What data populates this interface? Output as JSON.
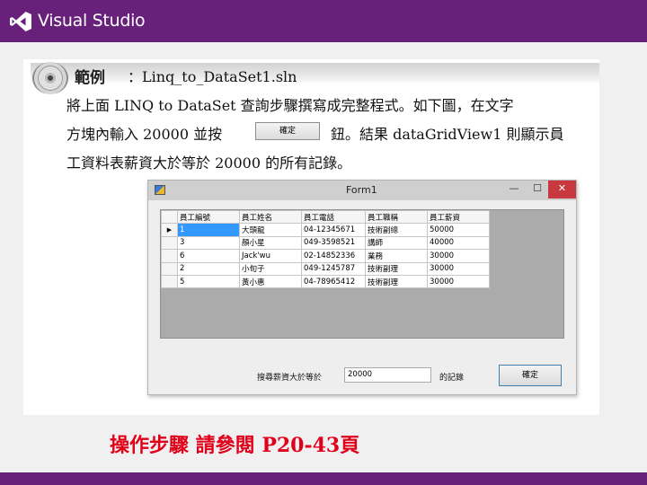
{
  "brand": {
    "name": "Visual Studio"
  },
  "example": {
    "tag": "範例",
    "file": "：Linq_to_DataSet1.sln"
  },
  "description": {
    "l1_a": "將上面 ",
    "l1_b": "LINQ to DataSet",
    "l1_c": " 查詢步驟撰寫成完整程式。如下圖，在文字",
    "l2_a": "方塊內輸入 ",
    "l2_b": "20000",
    "l2_c": " 並按",
    "l2_d": "鈕。結果 ",
    "l2_e": "dataGridView1",
    "l2_f": " 則顯示員",
    "l3_a": "工資料表薪資大於等於 ",
    "l3_b": "20000",
    "l3_c": " 的所有記錄。",
    "inline_button": "確定"
  },
  "window": {
    "title": "Form1",
    "min": "—",
    "max": "☐",
    "close": "✕"
  },
  "grid": {
    "columns": [
      "員工編號",
      "員工姓名",
      "員工電話",
      "員工職稱",
      "員工薪資"
    ],
    "rows": [
      [
        "1",
        "大頭龍",
        "04-12345671",
        "技術副總",
        "50000"
      ],
      [
        "3",
        "顏小星",
        "049-3598521",
        "講師",
        "40000"
      ],
      [
        "6",
        "Jack'wu",
        "02-14852336",
        "業務",
        "30000"
      ],
      [
        "2",
        "小旬子",
        "049-1245787",
        "技術副理",
        "30000"
      ],
      [
        "5",
        "黃小惠",
        "04-78965412",
        "技術副理",
        "30000"
      ]
    ]
  },
  "form": {
    "filter_label": "搜尋薪資大於等於",
    "filter_value": "20000",
    "filter_suffix": "的記錄",
    "ok_label": "確定"
  },
  "steps_note": "操作步驟 請參閱 P20-43頁",
  "colors": {
    "brand_purple": "#68217a",
    "steps_red": "#e0001a",
    "selection": "#3399ff",
    "close_red": "#c7393e"
  }
}
